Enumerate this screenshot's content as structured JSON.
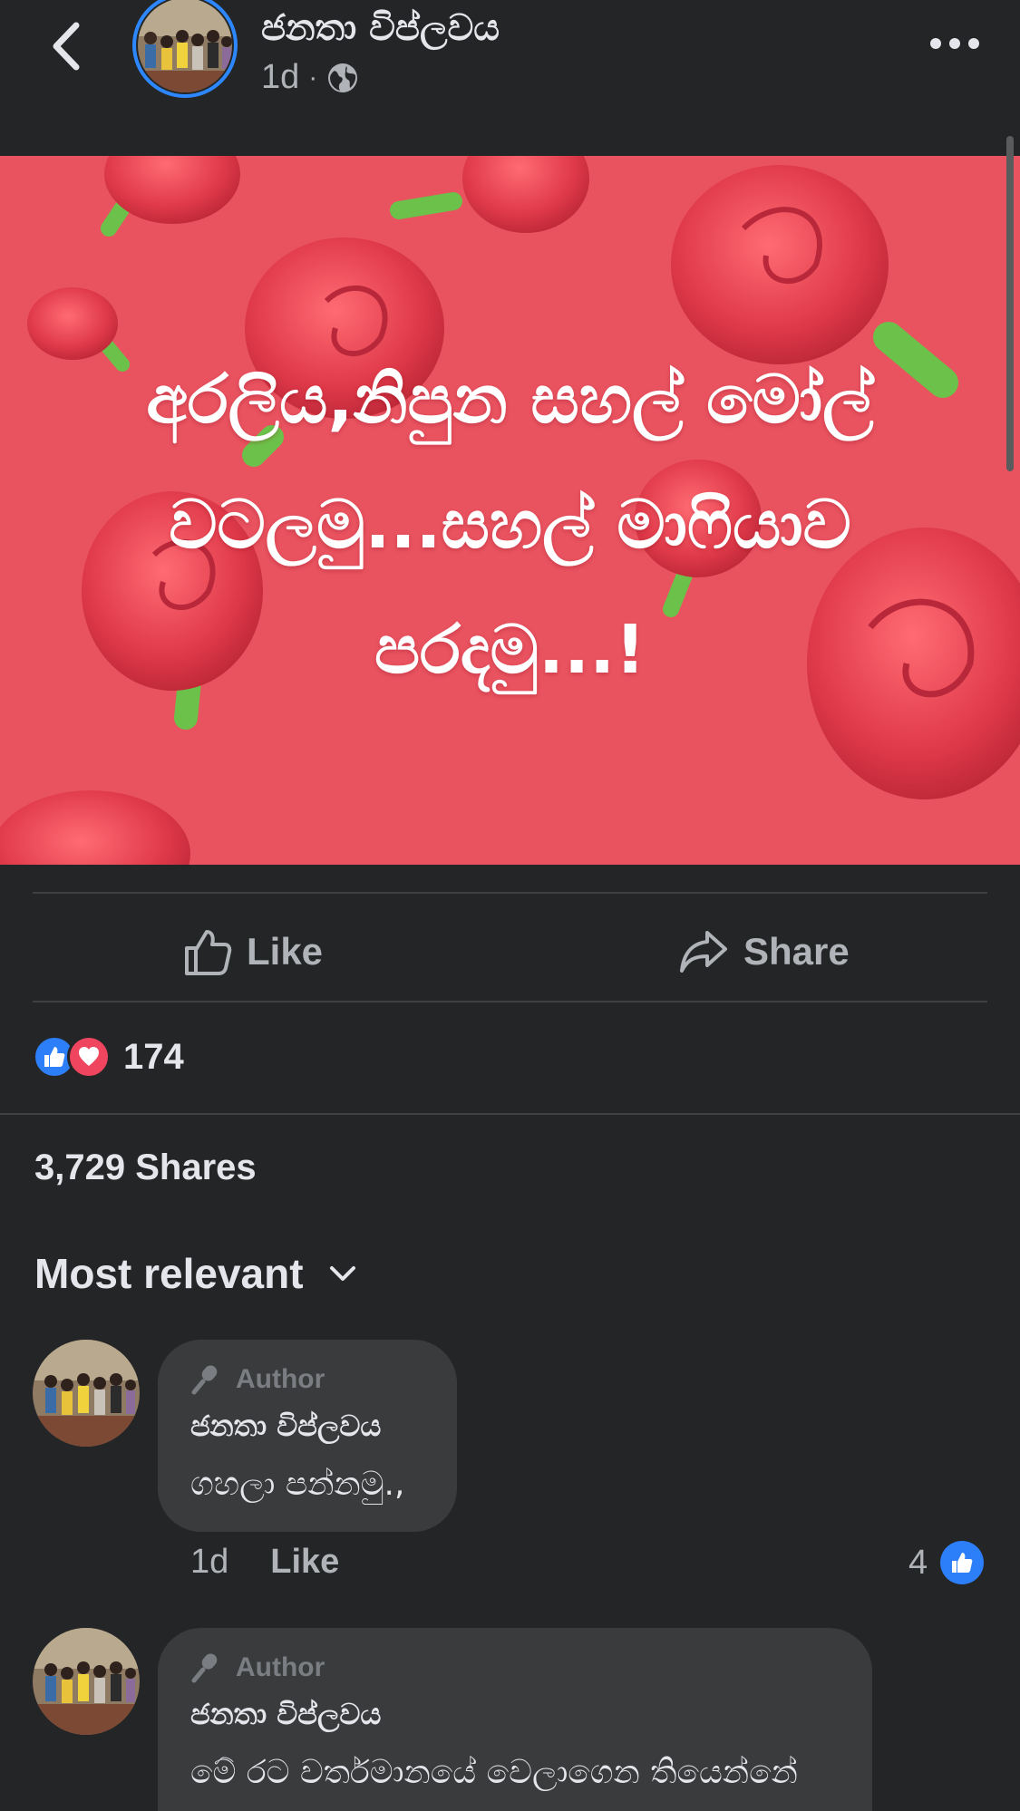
{
  "header": {
    "page_name": "ජනතා විප්ලවය",
    "time": "1d",
    "separator": "·",
    "privacy_icon": "globe-icon",
    "back_icon": "chevron-left-icon",
    "more_icon": "more-horizontal-icon"
  },
  "post": {
    "image_text": "අරලිය,නිපුන සහල් මෝල්\nවටලමු...සහල් මාෆියාව\nපරදමු...!",
    "image_background": "#e8505e"
  },
  "actions": {
    "like_label": "Like",
    "share_label": "Share"
  },
  "reactions": {
    "count": "174",
    "icons": [
      "like-reaction-icon",
      "love-reaction-icon"
    ]
  },
  "shares_text": "3,729 Shares",
  "sort": {
    "label": "Most relevant"
  },
  "comments": [
    {
      "tag": "Author",
      "name": "ජනතා විප්ලවය",
      "text": "ගහලා පන්නමු.,",
      "time": "1d",
      "like_label": "Like",
      "like_count": "4"
    },
    {
      "tag": "Author",
      "name": "ජනතා විප්ලවය",
      "text": "මේ රට වර්තමානයේ වෙලාගෙන තියෙන්නේ"
    }
  ],
  "colors": {
    "background": "#242526",
    "bubble": "#3a3b3c",
    "like_blue": "#2d7ff9",
    "love_red": "#f0455e",
    "avatar_ring": "#2d88ff"
  }
}
